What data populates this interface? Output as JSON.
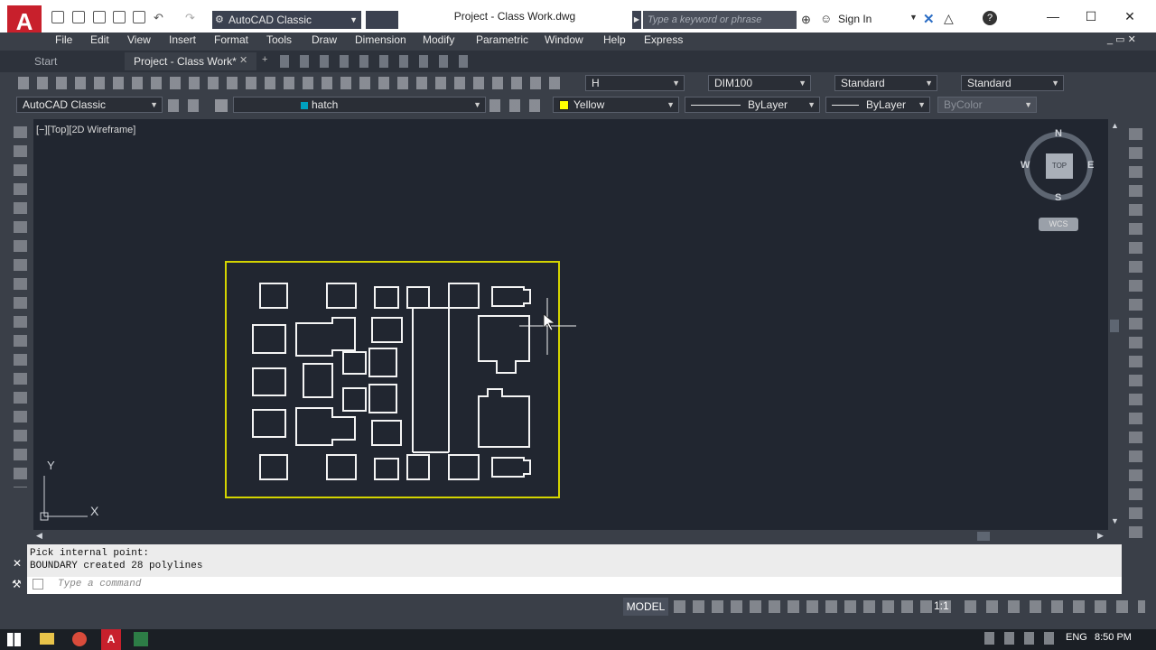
{
  "title_bar": {
    "workspace": "AutoCAD Classic",
    "document_title": "Project - Class Work.dwg",
    "search_placeholder": "Type a keyword or phrase",
    "sign_in": "Sign In"
  },
  "menu": [
    "File",
    "Edit",
    "View",
    "Insert",
    "Format",
    "Tools",
    "Draw",
    "Dimension",
    "Modify",
    "Parametric",
    "Window",
    "Help",
    "Express"
  ],
  "tabs": {
    "start": "Start",
    "active": "Project - Class Work*"
  },
  "toolbar1": {
    "text_style": "H",
    "dim_style": "DIM100",
    "table_style": "Standard",
    "mleader_style": "Standard"
  },
  "toolbar2": {
    "workspace": "AutoCAD Classic",
    "layer": "hatch",
    "color": "Yellow",
    "color_swatch": "#ffff00",
    "linetype": "ByLayer",
    "lineweight": "ByLayer",
    "plotstyle": "ByColor"
  },
  "viewport": {
    "label": "[−][Top][2D Wireframe]",
    "compass": {
      "n": "N",
      "s": "S",
      "e": "E",
      "w": "W",
      "top": "TOP"
    },
    "wcs": "WCS",
    "ucs_x": "X",
    "ucs_y": "Y"
  },
  "command": {
    "line1": "Pick internal point:",
    "line2": "BOUNDARY created 28 polylines",
    "placeholder": "Type a command"
  },
  "status": {
    "model": "MODEL",
    "scale": "1:1"
  },
  "taskbar": {
    "language": "ENG",
    "time": "8:50 PM"
  },
  "colors": {
    "accent": "#c8202c",
    "canvas": "#212630",
    "boundary": "#d4d400"
  }
}
